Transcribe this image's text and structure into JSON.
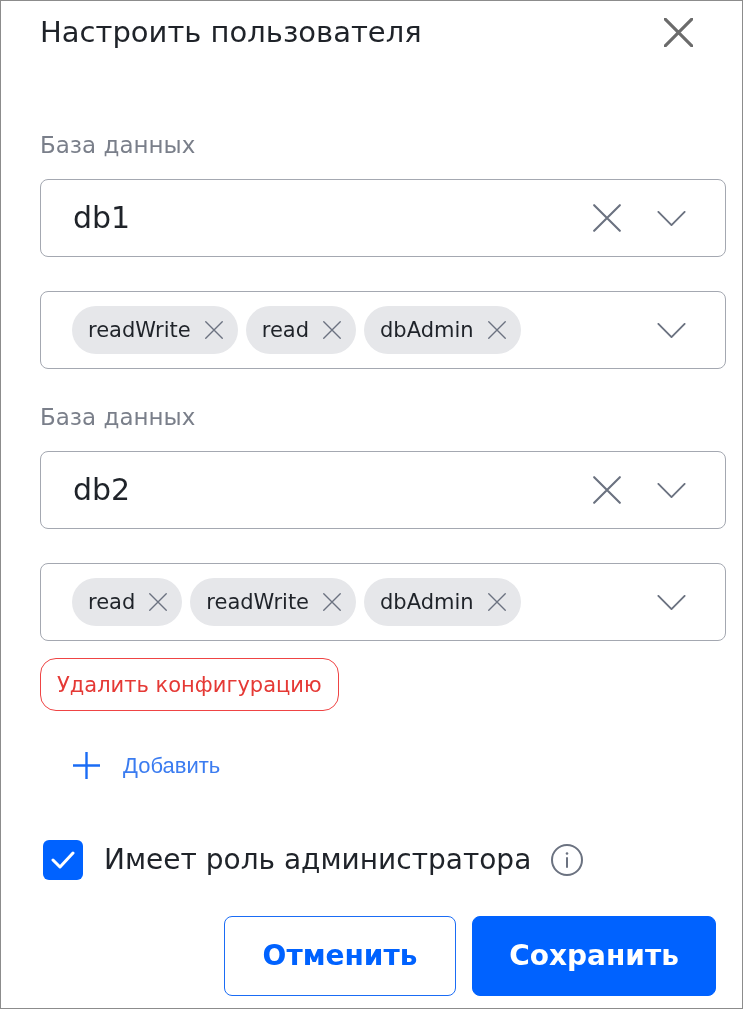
{
  "dialog": {
    "title": "Настроить пользователя"
  },
  "configurations": [
    {
      "database_label": "База данных",
      "database": "db1",
      "roles": [
        "readWrite",
        "read",
        "dbAdmin"
      ]
    },
    {
      "database_label": "База данных",
      "database": "db2",
      "roles": [
        "read",
        "readWrite",
        "dbAdmin"
      ]
    }
  ],
  "delete_button": "Удалить конфигурацию",
  "add_button": "Добавить",
  "admin_checkbox": {
    "label": "Имеет роль администратора",
    "checked": true
  },
  "buttons": [
    {
      "label": "Отменить",
      "kind": "secondary"
    },
    {
      "label": "Сохранить",
      "kind": "primary"
    }
  ]
}
